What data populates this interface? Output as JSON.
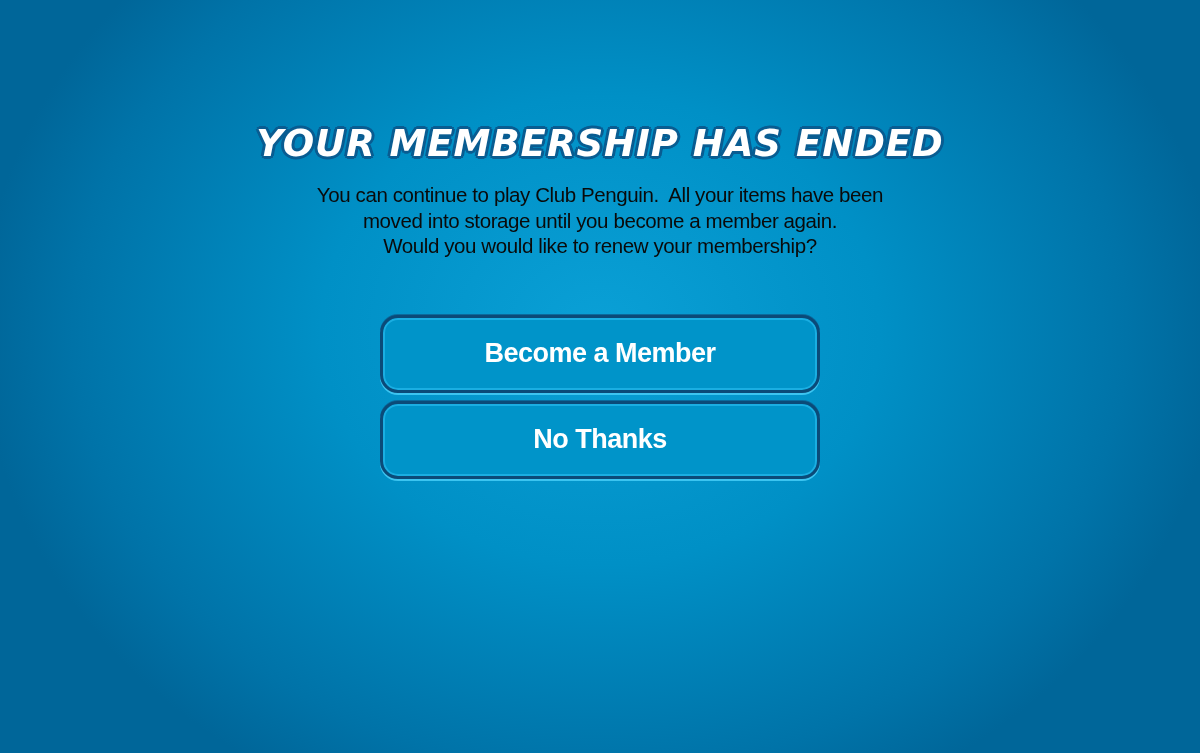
{
  "dialog": {
    "title": "YOUR MEMBERSHIP HAS ENDED",
    "message": "You can continue to play Club Penguin.  All your items have been\nmoved into storage until you become a member again.\nWould you would like to renew your membership?",
    "buttons": [
      {
        "label": "Become a Member"
      },
      {
        "label": "No Thanks"
      }
    ]
  }
}
